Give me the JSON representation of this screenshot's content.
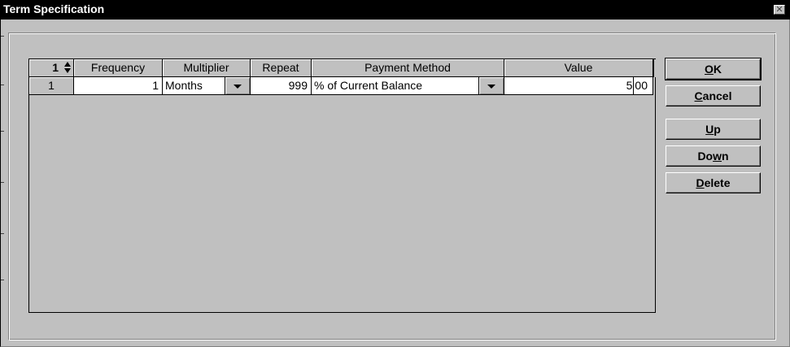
{
  "window": {
    "title": "Term Specification",
    "close_glyph": "✕"
  },
  "grid": {
    "record_counter": "1",
    "columns": [
      "Frequency",
      "Multiplier",
      "Repeat",
      "Payment Method",
      "Value"
    ],
    "rows": [
      {
        "row_number": "1",
        "frequency": "1",
        "multiplier": "Months",
        "repeat": "999",
        "payment_method": "% of Current Balance",
        "value_int": "5",
        "value_dec": "00"
      }
    ]
  },
  "buttons": {
    "ok": {
      "mnemonic": "O",
      "rest": "K"
    },
    "cancel": {
      "mnemonic": "C",
      "rest": "ancel"
    },
    "up": {
      "mnemonic": "U",
      "rest": "p"
    },
    "down": {
      "pre": "Do",
      "mnemonic": "w",
      "rest": "n"
    },
    "delete": {
      "mnemonic": "D",
      "rest": "elete"
    }
  },
  "icons": {
    "spinner": "up-down-spinner-icon",
    "dropdown": "chevron-down-icon",
    "close": "close-icon"
  },
  "colors": {
    "face": "#c0c0c0",
    "titlebar": "#000000",
    "cell": "#ffffff"
  }
}
